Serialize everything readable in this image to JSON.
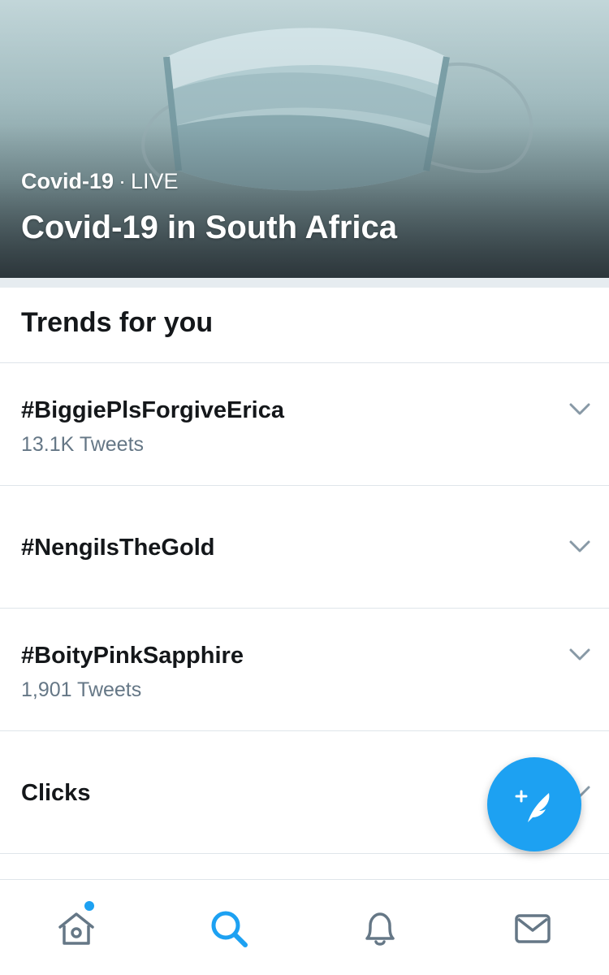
{
  "hero": {
    "category": "Covid-19",
    "separator": "·",
    "status": "LIVE",
    "title": "Covid-19 in South Africa"
  },
  "trends": {
    "header": "Trends for you",
    "items": [
      {
        "name": "#BiggiePlsForgiveErica",
        "count": "13.1K Tweets"
      },
      {
        "name": "#NengiIsTheGold",
        "count": ""
      },
      {
        "name": "#BoityPinkSapphire",
        "count": "1,901 Tweets"
      },
      {
        "name": "Clicks",
        "count": ""
      }
    ]
  },
  "fab": {
    "icon": "compose-tweet-icon"
  },
  "bottom_nav": {
    "items": [
      {
        "icon": "home-icon",
        "active": false,
        "has_notification_dot": true
      },
      {
        "icon": "search-icon",
        "active": true
      },
      {
        "icon": "notifications-bell-icon",
        "active": false
      },
      {
        "icon": "messages-envelope-icon",
        "active": false
      }
    ]
  },
  "colors": {
    "accent": "#1da1f2",
    "text_primary": "#14171a",
    "text_secondary": "#657786",
    "divider": "#dfe5ea",
    "icon_inactive": "#657786"
  }
}
